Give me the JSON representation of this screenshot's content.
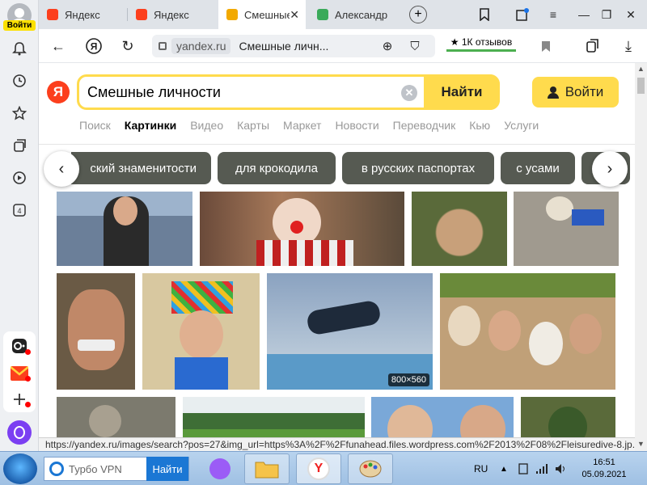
{
  "sidebar": {
    "login_label": "Войти",
    "workspace_count": "4"
  },
  "tabs": [
    {
      "label": "Яндекс",
      "color": "#fc3f1d"
    },
    {
      "label": "Яндекс",
      "color": "#fc3f1d"
    },
    {
      "label": "Смешные личн",
      "color": "#f2a900",
      "active": true
    },
    {
      "label": "Александр",
      "color": "#3aaa5a"
    }
  ],
  "address": {
    "domain": "yandex.ru",
    "page_title": "Смешные личн...",
    "reviews": "1К отзывов"
  },
  "search": {
    "query": "Смешные личности",
    "find_label": "Найти",
    "login_label": "Войти"
  },
  "services": [
    "Поиск",
    "Картинки",
    "Видео",
    "Карты",
    "Маркет",
    "Новости",
    "Переводчик",
    "Кью",
    "Услуги"
  ],
  "chips": [
    "ский знаменитости",
    "для крокодила",
    "в русских паспортах",
    "с усами",
    ""
  ],
  "images": {
    "row1": [
      "#6b7f99",
      "#9a5a4a",
      "#8a7a5a",
      "#a09a8f"
    ],
    "row2": [
      "#6a5a45",
      "#c9a35a",
      "#7b93b0",
      "#c0a078"
    ],
    "row3": [
      "#7c7a6e",
      "#3e6e36",
      "#b08a6a",
      "#5a6a3a"
    ],
    "badge": "800×560"
  },
  "status_url": "https://yandex.ru/images/search?pos=27&img_url=https%3A%2F%2Ffunahead.files.wordpress.com%2F2013%2F08%2Fleisuredive-8.jp...",
  "taskbar": {
    "search_text": "Турбо VPN",
    "search_button": "Найти",
    "lang": "RU",
    "time": "16:51",
    "date": "05.09.2021"
  }
}
